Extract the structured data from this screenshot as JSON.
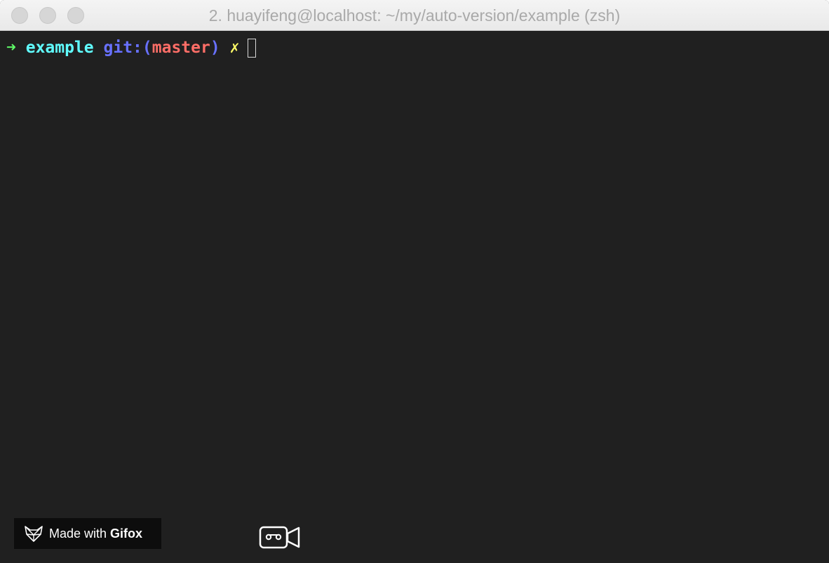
{
  "window": {
    "title": "2. huayifeng@localhost: ~/my/auto-version/example (zsh)"
  },
  "prompt": {
    "arrow": "➜",
    "directory": "example",
    "git_prefix": "git:(",
    "branch": "master",
    "git_suffix": ")",
    "dirty_marker": "✗"
  },
  "watermark": {
    "made_with": "Made with",
    "brand": "Gifox"
  },
  "icons": {
    "logo": "fox-head-icon",
    "recorder": "video-camera-icon"
  },
  "colors": {
    "terminal_bg": "#202020",
    "arrow": "#5ff967",
    "directory": "#60fdff",
    "git": "#6871ff",
    "branch": "#ff6e67",
    "dirty_marker": "#fffc67"
  }
}
